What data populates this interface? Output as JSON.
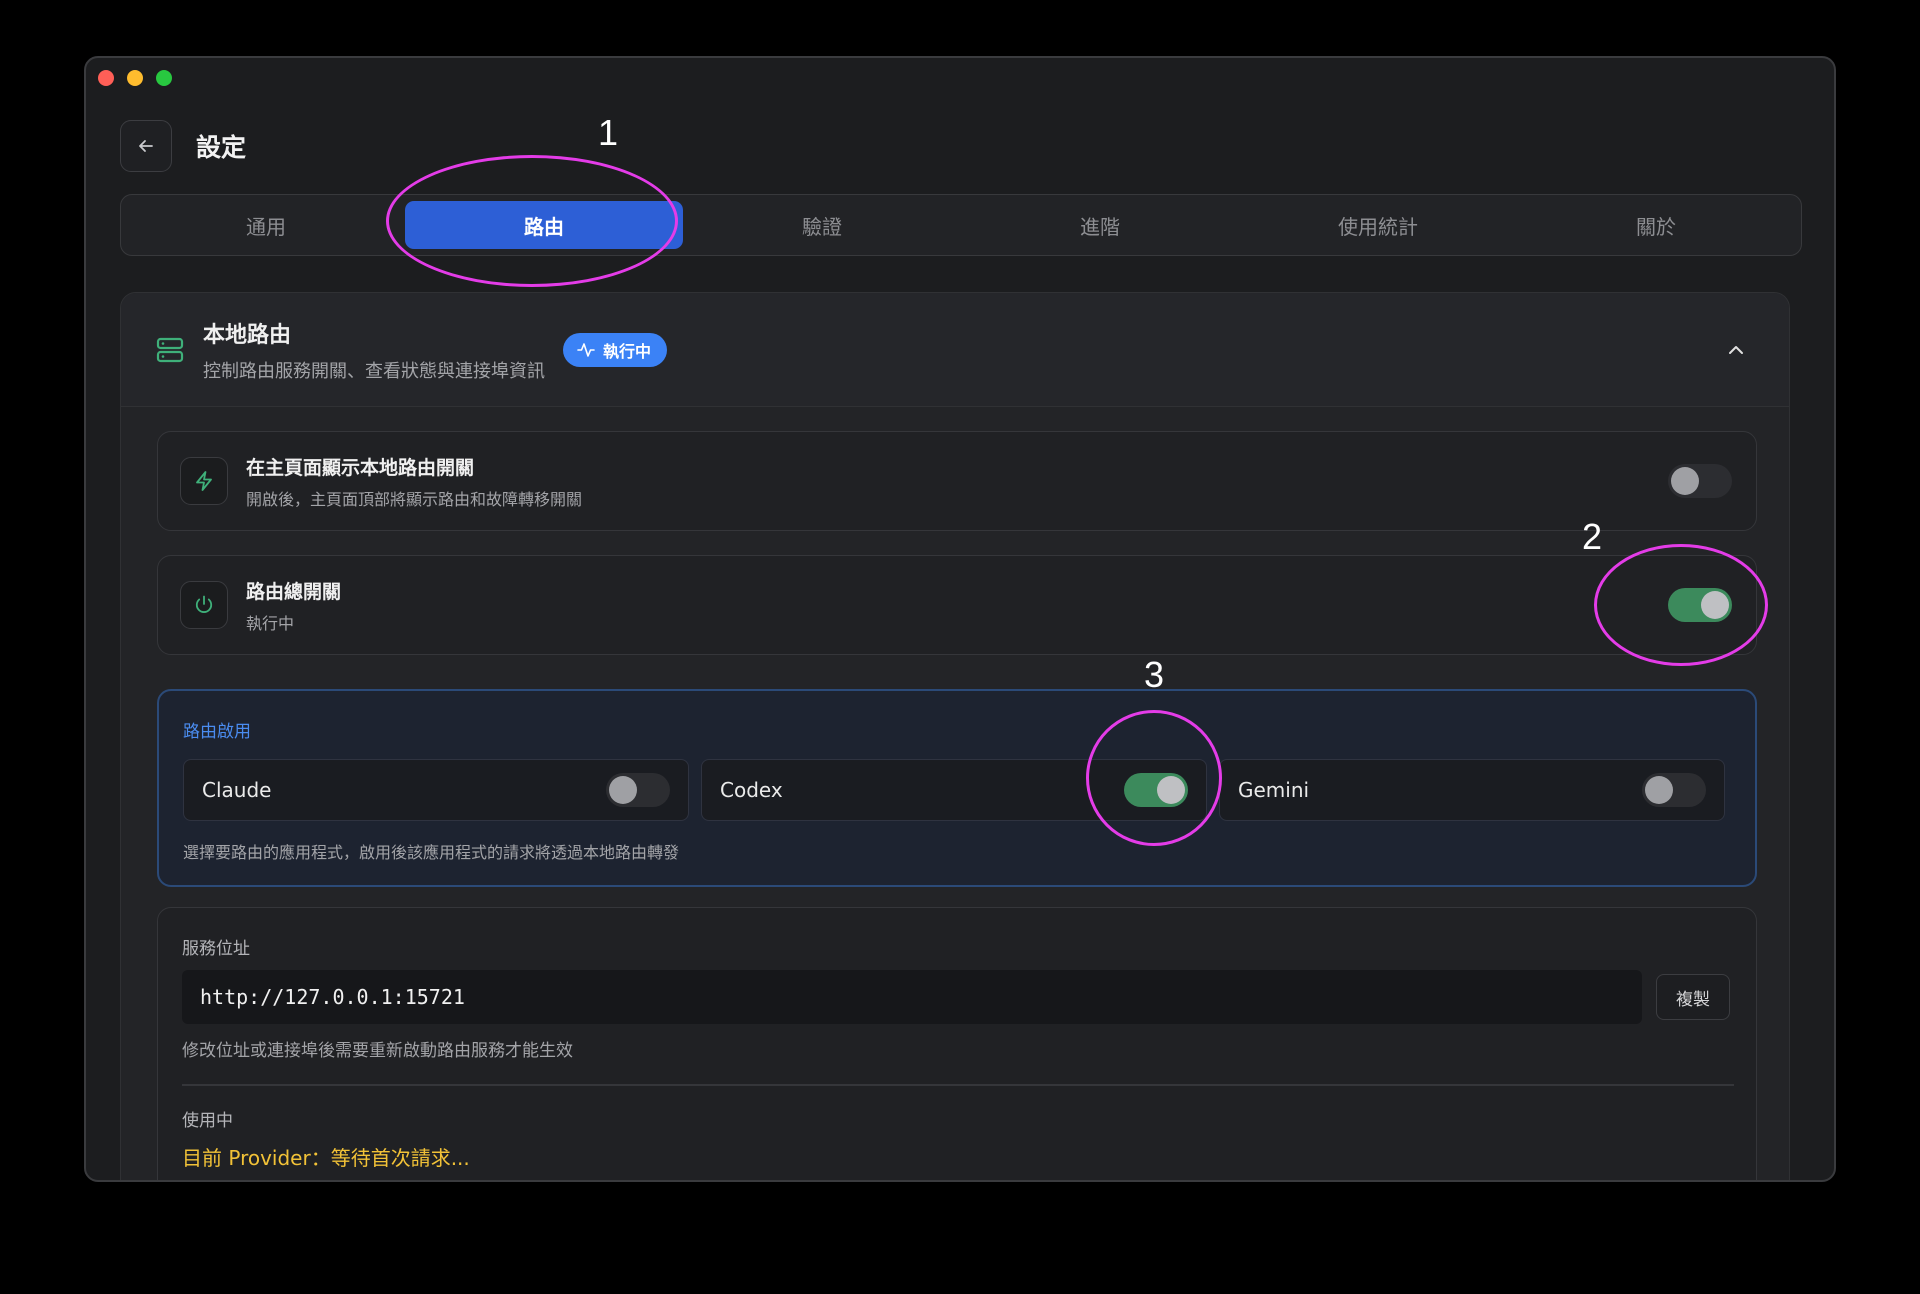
{
  "window": {
    "title": "設定"
  },
  "tabs": [
    {
      "label": "通用",
      "active": false
    },
    {
      "label": "路由",
      "active": true
    },
    {
      "label": "驗證",
      "active": false
    },
    {
      "label": "進階",
      "active": false
    },
    {
      "label": "使用統計",
      "active": false
    },
    {
      "label": "關於",
      "active": false
    }
  ],
  "section": {
    "title": "本地路由",
    "subtitle": "控制路由服務開關、查看狀態與連接埠資訊",
    "badge": "執行中",
    "collapse_icon": "chevron-up-icon"
  },
  "rows": {
    "show_toggle": {
      "title": "在主頁面顯示本地路由開關",
      "subtitle": "開啟後，主頁面頂部將顯示路由和故障轉移開關",
      "icon": "lightning-icon",
      "enabled": false
    },
    "master_switch": {
      "title": "路由總開關",
      "subtitle": "執行中",
      "icon": "power-icon",
      "enabled": true
    }
  },
  "apps": {
    "label": "路由啟用",
    "items": [
      {
        "name": "Claude",
        "enabled": false
      },
      {
        "name": "Codex",
        "enabled": true
      },
      {
        "name": "Gemini",
        "enabled": false
      }
    ],
    "note": "選擇要路由的應用程式，啟用後該應用程式的請求將透過本地路由轉發"
  },
  "service": {
    "label": "服務位址",
    "address": "http://127.0.0.1:15721",
    "copy_label": "複製",
    "note": "修改位址或連接埠後需要重新啟動路由服務才能生效",
    "inuse_label": "使用中",
    "provider_line": "目前 Provider：等待首次請求..."
  },
  "annotations": {
    "labels": [
      "1",
      "2",
      "3"
    ],
    "color": "#e43ce8"
  },
  "colors": {
    "accent": "#2d5fd6",
    "badge": "#3b82f6",
    "switch_on": "#3c8a5c",
    "icon_green": "#3fb07a",
    "provider_text": "#f2c237"
  }
}
